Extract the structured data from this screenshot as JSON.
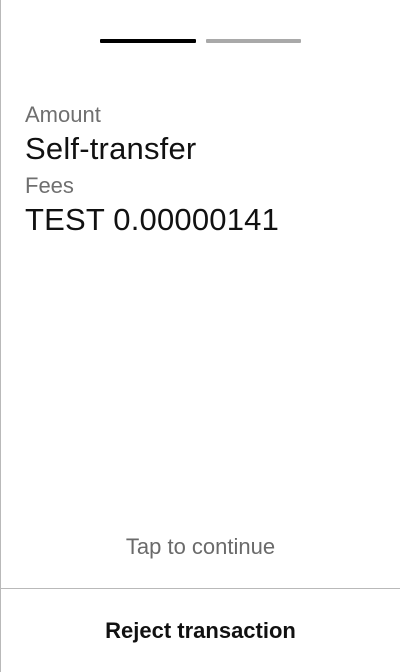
{
  "steps": {
    "total": 2,
    "current": 1
  },
  "details": {
    "amount_label": "Amount",
    "amount_value": "Self-transfer",
    "fees_label": "Fees",
    "fees_value": "TEST 0.00000141"
  },
  "hint": "Tap to continue",
  "footer": {
    "reject_label": "Reject transaction"
  },
  "colors": {
    "text_primary": "#111111",
    "text_secondary": "#6f6f6f",
    "progress_active": "#000000",
    "progress_inactive": "#a9a9a9",
    "divider": "#b9b9b9"
  }
}
